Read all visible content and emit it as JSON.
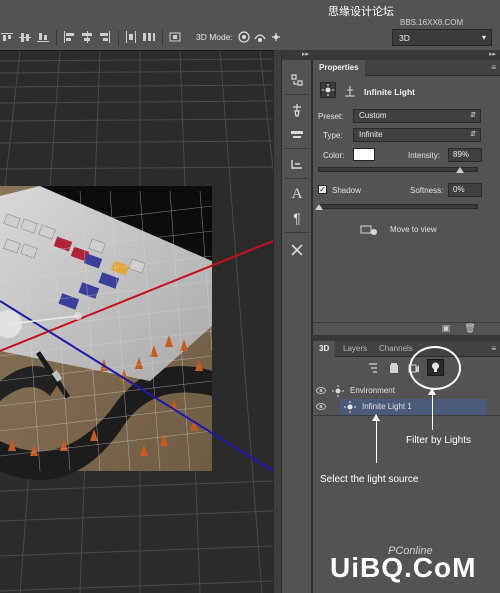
{
  "watermarks": {
    "top_line1": "思缘设计论坛",
    "top_line2": "BBS.16XX8.COM",
    "bottom_brand": "UiBQ.CoM",
    "bottom_small": "PConline"
  },
  "options_bar": {
    "mode_label": "3D Mode:",
    "workspace_value": "3D"
  },
  "properties_panel": {
    "tab_label": "Properties",
    "header_title": "Infinite Light",
    "preset_label": "Preset:",
    "preset_value": "Custom",
    "type_label": "Type:",
    "type_value": "Infinite",
    "color_label": "Color:",
    "color_value": "#ffffff",
    "intensity_label": "Intensity:",
    "intensity_value": "89%",
    "intensity_fraction": 0.89,
    "shadow_label": "Shadow",
    "shadow_checked": true,
    "softness_label": "Softness:",
    "softness_value": "0%",
    "move_to_view_label": "Move to view"
  },
  "layers_panel": {
    "tabs": [
      "3D",
      "Layers",
      "Channels"
    ],
    "active_tab": "3D",
    "items": [
      {
        "label": "Environment",
        "selected": false
      },
      {
        "label": "Infinite Light 1",
        "selected": true
      }
    ]
  },
  "annotations": {
    "filter_by_lights": "Filter by Lights",
    "select_light_source": "Select the light source"
  },
  "colors": {
    "panel_bg": "#535353",
    "canvas_bg": "#2e2e2e",
    "selected_row": "#4a5a78",
    "axis_red": "#c8101a",
    "axis_blue": "#1a1ab0",
    "callout": "#ffffff"
  }
}
